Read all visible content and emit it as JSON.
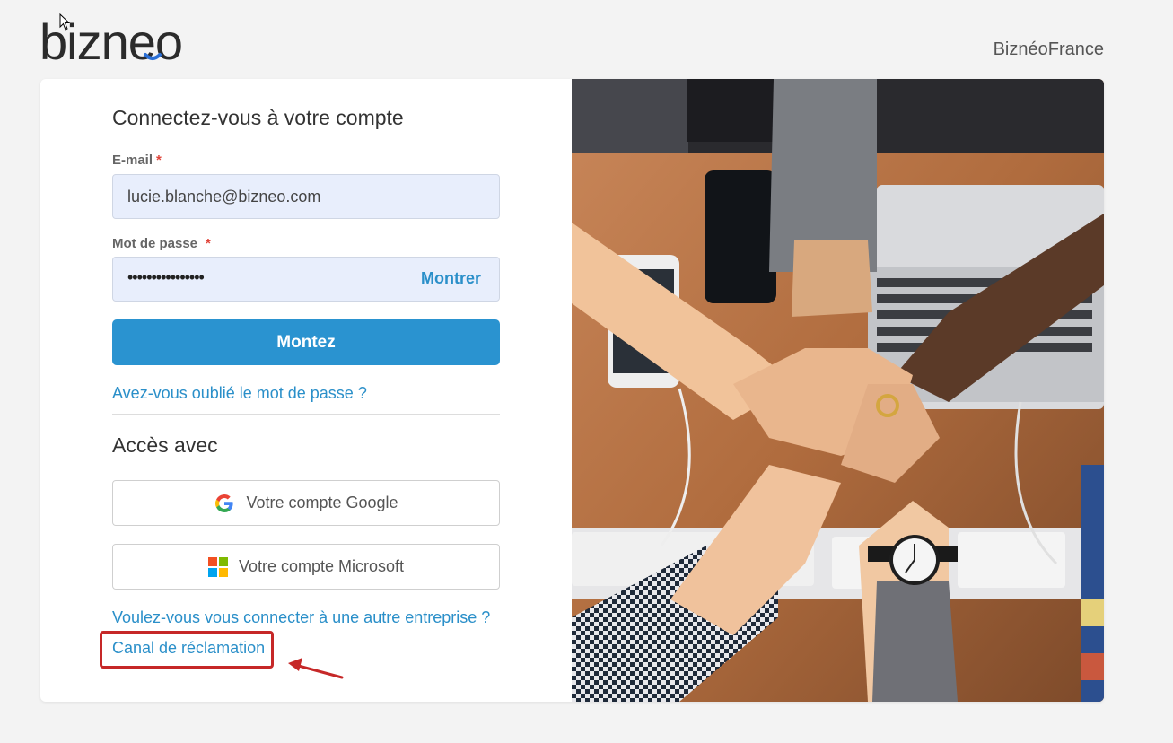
{
  "header": {
    "logo_text": "bizneo",
    "company_name": "BiznéoFrance"
  },
  "form": {
    "title": "Connectez-vous à votre compte",
    "email_label": "E-mail",
    "email_required": "*",
    "email_value": "lucie.blanche@bizneo.com",
    "password_label": "Mot de passe",
    "password_required": "*",
    "password_mask": "••••••••••••••••",
    "show_password_label": "Montrer",
    "submit_label": "Montez",
    "forgot_password_link": "Avez-vous oublié le mot de passe ?"
  },
  "access": {
    "title": "Accès avec",
    "google_label": "Votre compte Google",
    "microsoft_label": "Votre compte Microsoft",
    "other_company_link": "Voulez-vous vous connecter à une autre entreprise ?",
    "complaint_link": "Canal de réclamation"
  },
  "colors": {
    "accent": "#2a93d0",
    "link": "#2a8fc9",
    "input_bg": "#e8eefc",
    "required": "#e0443a",
    "annotation": "#c62828"
  },
  "icons": {
    "google": "google-logo-icon",
    "microsoft": "microsoft-logo-icon",
    "cursor": "mouse-cursor-icon",
    "annotation_arrow": "arrow-left-icon"
  }
}
